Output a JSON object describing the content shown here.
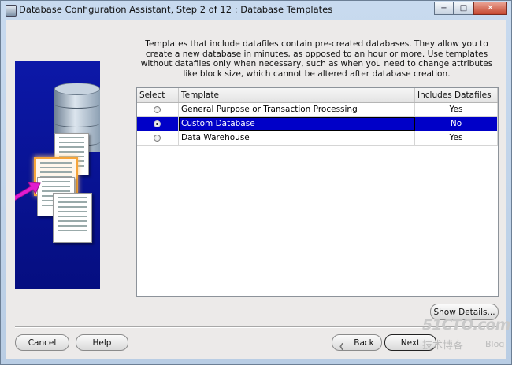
{
  "window": {
    "title": "Database Configuration Assistant, Step 2 of 12 : Database Templates",
    "controls": {
      "minimize": "−",
      "maximize": "□",
      "close": "✕"
    }
  },
  "description": "Templates that include datafiles contain pre-created databases. They allow you to create a new database in minutes, as opposed to an hour or more. Use templates without datafiles only when necessary, such as when you need to change attributes like block size, which cannot be altered after database creation.",
  "table": {
    "headers": {
      "select": "Select",
      "template": "Template",
      "datafiles": "Includes Datafiles"
    },
    "rows": [
      {
        "template": "General Purpose or Transaction Processing",
        "datafiles": "Yes",
        "selected": false
      },
      {
        "template": "Custom Database",
        "datafiles": "No",
        "selected": true
      },
      {
        "template": "Data Warehouse",
        "datafiles": "Yes",
        "selected": false
      }
    ]
  },
  "buttons": {
    "show_details": "Show Details...",
    "cancel": "Cancel",
    "help": "Help",
    "back": "Back",
    "next": "Next"
  },
  "watermark": {
    "line1": "51CTO.com",
    "line2": "技术博客",
    "line3": "Blog"
  },
  "colors": {
    "selection": "#0000c8",
    "panel": "#eceae9",
    "art_background": "#0c18a8"
  }
}
